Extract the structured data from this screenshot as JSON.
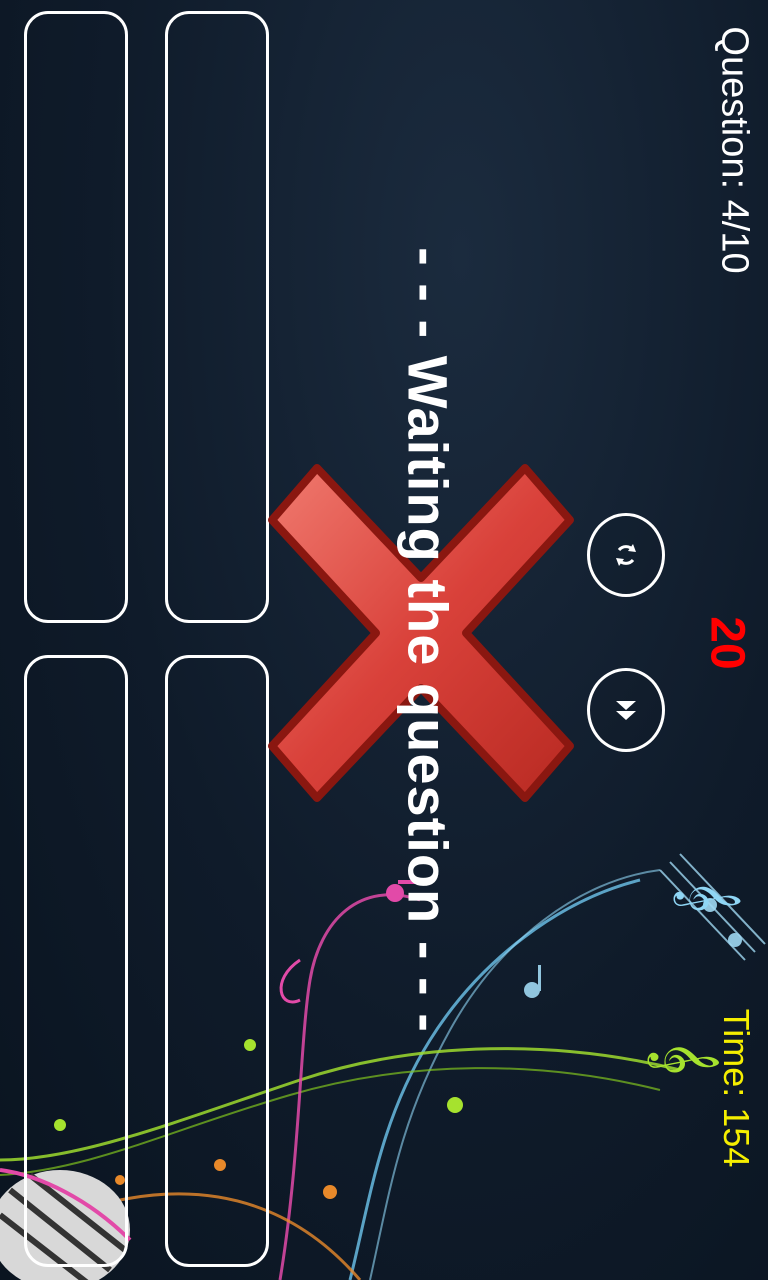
{
  "header": {
    "question_counter": "Question: 4/10",
    "timer": "Time: 154",
    "score": "20"
  },
  "status_message": "- - - Waiting the question - - -",
  "answers": [
    {
      "id": "answer-1",
      "label": ""
    },
    {
      "id": "answer-2",
      "label": ""
    },
    {
      "id": "answer-3",
      "label": ""
    },
    {
      "id": "answer-4",
      "label": ""
    }
  ],
  "controls": {
    "replay_icon": "replay-icon",
    "skip_icon": "fast-forward-icon"
  },
  "feedback": {
    "icon": "wrong-answer-x-icon",
    "color": "#d9413a"
  },
  "colors": {
    "timer": "#f5ee00",
    "score": "#ff0000",
    "text": "#ffffff"
  }
}
